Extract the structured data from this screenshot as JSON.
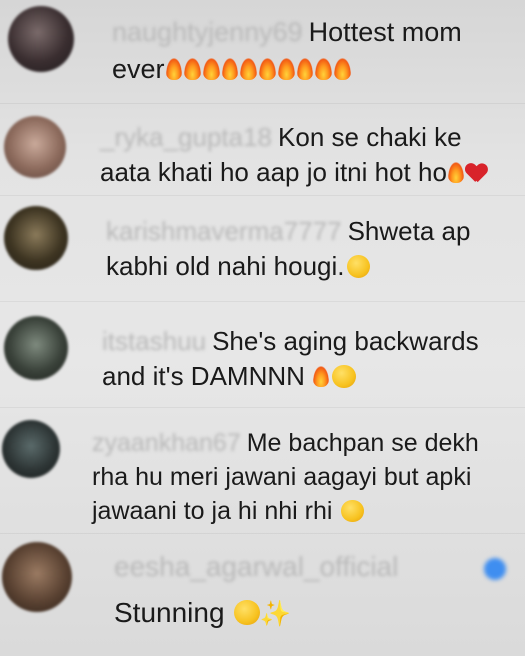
{
  "comments": [
    {
      "username": "naughtyjenny69",
      "line1": "Hottest mom",
      "line2": "ever",
      "emoji_1": "fire-x10"
    },
    {
      "username": "_ryka_gupta18",
      "line1": "Kon se chaki ke",
      "line2": "aata khati ho aap jo itni hot ho",
      "emoji_1": "fire",
      "emoji_2": "red-heart"
    },
    {
      "username": "karishmaverma7777",
      "line1": "Shweta ap",
      "line2": "kabhi old nahi hougi.",
      "emoji_1": "face-with-tears-of-joy"
    },
    {
      "username": "itstashuu",
      "line1": "She's aging backwards",
      "line2": "and it's DAMNNN",
      "emoji_1": "fire",
      "emoji_2": "smiling-face-with-heart-eyes"
    },
    {
      "username": "zyaankhan67",
      "line1": "Me bachpan se dekh",
      "line2": "rha hu meri jawani aagayi but apki",
      "line3": "jawaani to ja hi nhi rhi",
      "emoji_1": "face-with-tears-of-joy"
    },
    {
      "username": "eesha_agarwal_official",
      "line1": "Stunning",
      "emoji_1": "star-struck",
      "emoji_2": "sparkles",
      "verified": "verified-badge-icon"
    }
  ],
  "colors": {
    "background": "#e4e4e4",
    "text": "#1a1a1a",
    "username_blur": "#b9b9b9",
    "verified": "#3f8ef0"
  }
}
